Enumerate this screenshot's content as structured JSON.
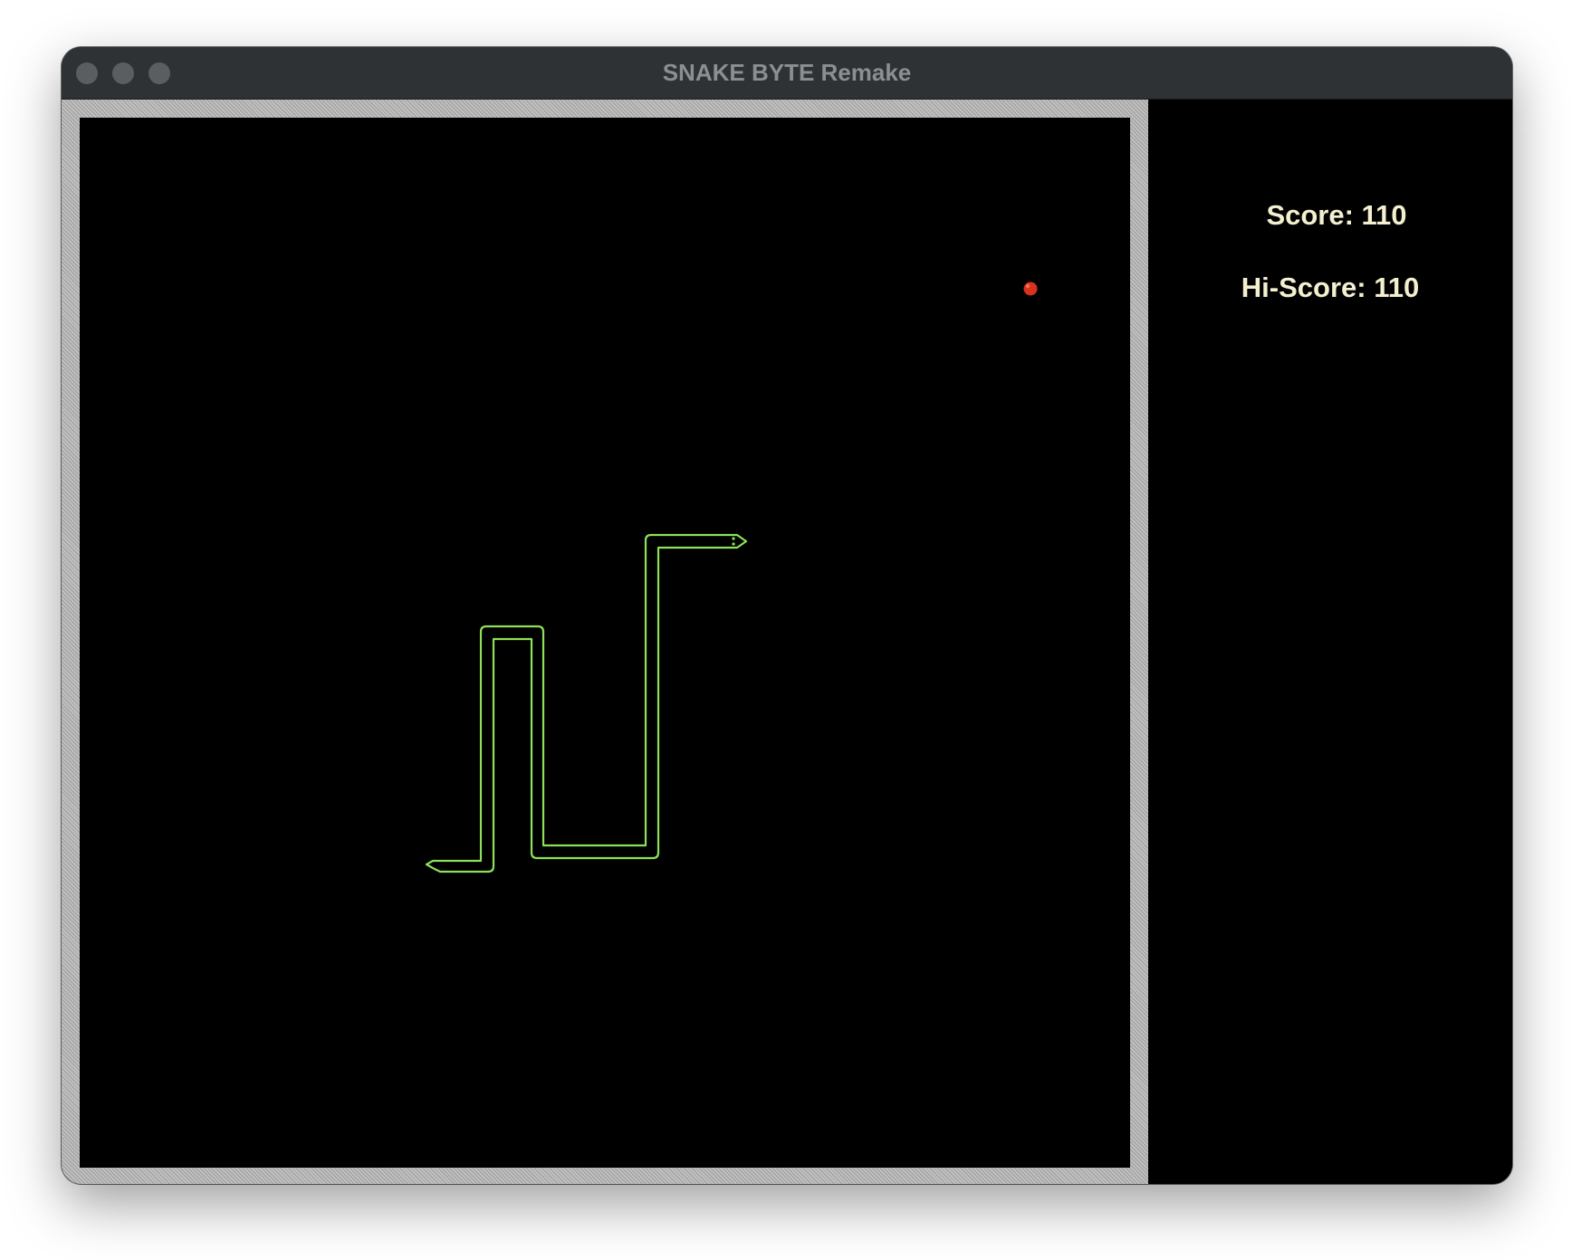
{
  "window": {
    "title": "SNAKE BYTE Remake"
  },
  "sidebar": {
    "score_text": "Score: 110",
    "hiscore_text": "Hi-Score: 110",
    "text_color": "#f3efcf"
  },
  "game": {
    "score": 110,
    "hi_score": 110,
    "snake_color": "#8ee05a",
    "food_color": "#d8321e",
    "background_color": "#000000",
    "snake_heading": "right"
  },
  "icons": {
    "traffic_close": "close-dot-icon",
    "traffic_minimize": "minimize-dot-icon",
    "traffic_maximize": "maximize-dot-icon"
  }
}
